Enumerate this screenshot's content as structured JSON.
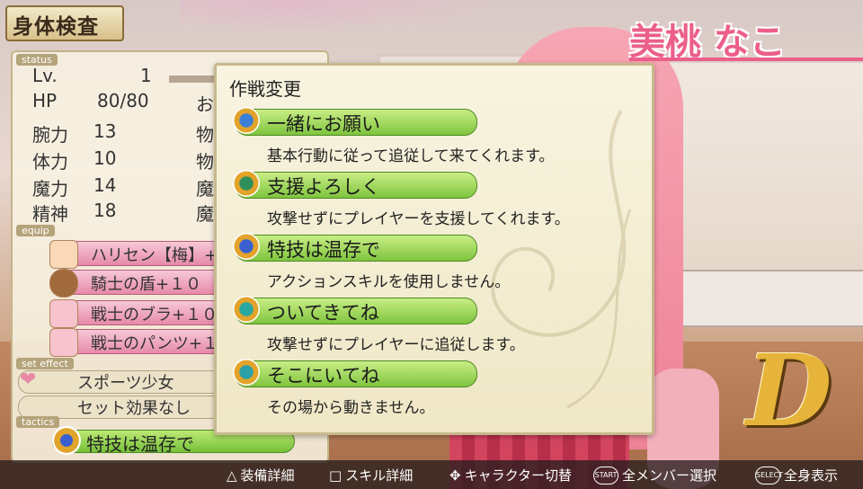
{
  "screen": {
    "title": "身体検査",
    "character_name": "美桃 なこ",
    "grade": "D"
  },
  "status": {
    "section_label": "status",
    "lv_label": "Lv.",
    "lv_value": "1",
    "hp_label": "HP",
    "hp_value": "80/80",
    "hp_side": "お",
    "stats": [
      {
        "label": "腕力",
        "value": "13",
        "side": "物"
      },
      {
        "label": "体力",
        "value": "10",
        "side": "物"
      },
      {
        "label": "魔力",
        "value": "14",
        "side": "魔"
      },
      {
        "label": "精神",
        "value": "18",
        "side": "魔"
      }
    ]
  },
  "equip": {
    "section_label": "equip",
    "items": [
      {
        "name": "ハリセン【梅】+",
        "icon": "paper-fan-icon"
      },
      {
        "name": "騎士の盾+１０",
        "icon": "shield-icon"
      },
      {
        "name": "戦士のブラ+１０",
        "icon": "bra-icon"
      },
      {
        "name": "戦士のパンツ+１",
        "icon": "pants-icon"
      }
    ]
  },
  "set_effect": {
    "section_label": "set effect",
    "name": "スポーツ少女",
    "effect": "セット効果なし"
  },
  "tactics": {
    "section_label": "tactics",
    "current": "特技は温存で"
  },
  "popup": {
    "title": "作戦変更",
    "options": [
      {
        "label": "一緒にお願い",
        "desc": "基本行動に従って追従して来てくれます。",
        "icon": "follow-icon",
        "icon_color": "#3b7fd6"
      },
      {
        "label": "支援よろしく",
        "desc": "攻撃せずにプレイヤーを支援してくれます。",
        "icon": "support-icon",
        "icon_color": "#2f8f5a"
      },
      {
        "label": "特技は温存で",
        "desc": "アクションスキルを使用しません。",
        "icon": "no-skill-icon",
        "icon_color": "#3a5fd0"
      },
      {
        "label": "ついてきてね",
        "desc": "攻撃せずにプレイヤーに追従します。",
        "icon": "follow-player-icon",
        "icon_color": "#28a8a0"
      },
      {
        "label": "そこにいてね",
        "desc": "その場から動きません。",
        "icon": "stay-icon",
        "icon_color": "#2aa0a8"
      }
    ]
  },
  "hints": [
    {
      "glyph": "△",
      "label": "装備詳細"
    },
    {
      "glyph": "□",
      "label": "スキル詳細"
    },
    {
      "glyph": "✥",
      "label": "キャラクター切替"
    },
    {
      "glyph": "START",
      "label": "全メンバー選択"
    },
    {
      "glyph": "SELECT",
      "label": "全身表示"
    }
  ]
}
